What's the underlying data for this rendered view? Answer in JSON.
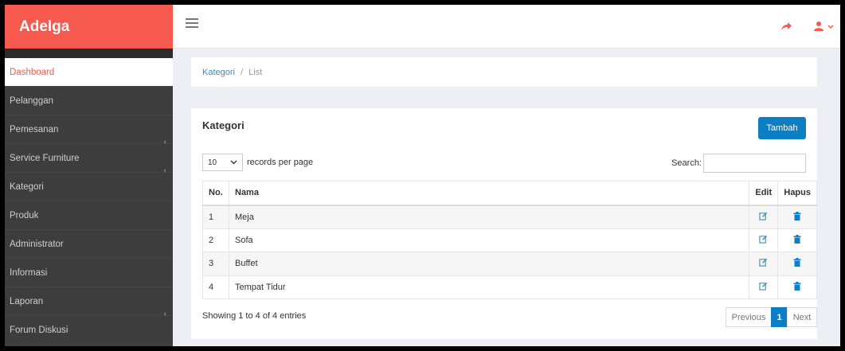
{
  "app": {
    "brand": "Adelga"
  },
  "colors": {
    "brand": "#f65a4e",
    "primary": "#0d7ec4",
    "sidebar": "#3d3d3d"
  },
  "header": {
    "menu_icon": "hamburger-icon",
    "share_icon": "share-icon",
    "user_icon": "user-icon"
  },
  "sidebar": {
    "items": [
      {
        "label": "Dashboard",
        "active": true
      },
      {
        "label": "Pelanggan"
      },
      {
        "label": "Pemesanan",
        "chevron": "‹"
      },
      {
        "label": "Service Furniture",
        "chevron": "‹"
      },
      {
        "label": "Kategori"
      },
      {
        "label": "Produk"
      },
      {
        "label": "Administrator"
      },
      {
        "label": "Informasi"
      },
      {
        "label": "Laporan",
        "chevron": "‹"
      },
      {
        "label": "Forum Diskusi"
      }
    ]
  },
  "breadcrumb": {
    "link": "Kategori",
    "sep": "/",
    "current": "List"
  },
  "panel": {
    "title": "Kategori",
    "add_label": "Tambah",
    "length_value": "10",
    "length_suffix": "records per page",
    "search_label": "Search:",
    "search_value": ""
  },
  "table": {
    "headers": {
      "no": "No.",
      "nama": "Nama",
      "edit": "Edit",
      "hapus": "Hapus"
    },
    "rows": [
      {
        "no": "1",
        "nama": "Meja"
      },
      {
        "no": "2",
        "nama": "Sofa"
      },
      {
        "no": "3",
        "nama": "Buffet"
      },
      {
        "no": "4",
        "nama": "Tempat Tidur"
      }
    ]
  },
  "footer": {
    "info": "Showing 1 to 4 of 4 entries",
    "prev": "Previous",
    "current": "1",
    "next": "Next"
  }
}
